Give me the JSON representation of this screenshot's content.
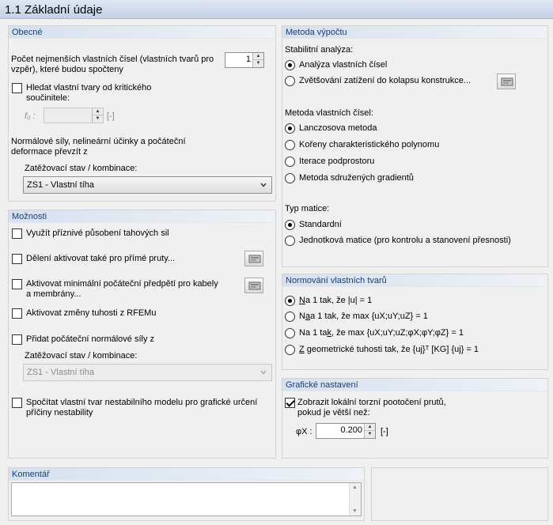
{
  "title": "1.1 Základní údaje",
  "general": {
    "header": "Obecné",
    "eigen_count_label": "Počet nejmenších vlastních čísel (vlastních tvarů pro vzpěr), které budou spočteny",
    "eigen_count_value": "1",
    "find_critical_label": "Hledat vlastní tvary od kritického součinitele:",
    "f0_label": "f₀ :",
    "f0_value": "",
    "f0_unit": "[-]",
    "normal_forces_label": "Normálové síly, nelineární účinky a počáteční deformace převzít z",
    "load_case_label": "Zatěžovací stav / kombinace:",
    "load_case_value": "ZS1 - Vlastní tíha"
  },
  "options": {
    "header": "Možnosti",
    "tension_label": "Využít příznivé působení tahových sil",
    "division_label": "Dělení aktivovat také pro přímé pruty...",
    "prestress_label": "Aktivovat minimální počáteční předpětí pro kabely a membrány...",
    "stiffness_label": "Aktivovat změny tuhosti z RFEMu",
    "add_normal_label": "Přidat počáteční normálové síly z",
    "load_case_label": "Zatěžovací stav / kombinace:",
    "load_case_value": "ZS1 - Vlastní tíha",
    "unstable_label": "Spočítat vlastní tvar nestabilního modelu pro grafické určení příčiny nestability"
  },
  "method": {
    "header": "Metoda výpočtu",
    "stability_label": "Stabilitní analýza:",
    "stability_opt1": "Analýza vlastních čísel",
    "stability_opt2": "Zvětšování zatížení do kolapsu konstrukce...",
    "eigen_method_label": "Metoda vlastních čísel:",
    "eigen_opt1": "Lanczosova metoda",
    "eigen_opt2": "Kořeny charakteristického polynomu",
    "eigen_opt3": "Iterace podprostoru",
    "eigen_opt4": "Metoda sdružených gradientů",
    "matrix_label": "Typ matice:",
    "matrix_opt1": "Standardní",
    "matrix_opt2": "Jednotková matice (pro kontrolu a stanovení přesnosti)"
  },
  "normalization": {
    "header": "Normování vlastních tvarů",
    "opt1_rest": "a 1 tak, že |u| = 1",
    "opt2_rest": "a 1 tak, že max {uX;uY;uZ} = 1",
    "opt3_pre": "Na 1 ta",
    "opt3_k": "k",
    "opt3_rest": ", že max {uX;uY;uZ;φX;φY;φZ} = 1",
    "opt4_rest": " geometrické tuhosti tak, že {uj}ᵀ [KG] {uj} = 1"
  },
  "graphics": {
    "header": "Grafické nastavení",
    "show_torsion_label": "Zobrazit lokální torzní pootočení prutů, pokud je větší než:",
    "phi_label": "φX :",
    "phi_value": "0.200",
    "phi_unit": "[-]"
  },
  "comment": {
    "header": "Komentář",
    "value": ""
  }
}
